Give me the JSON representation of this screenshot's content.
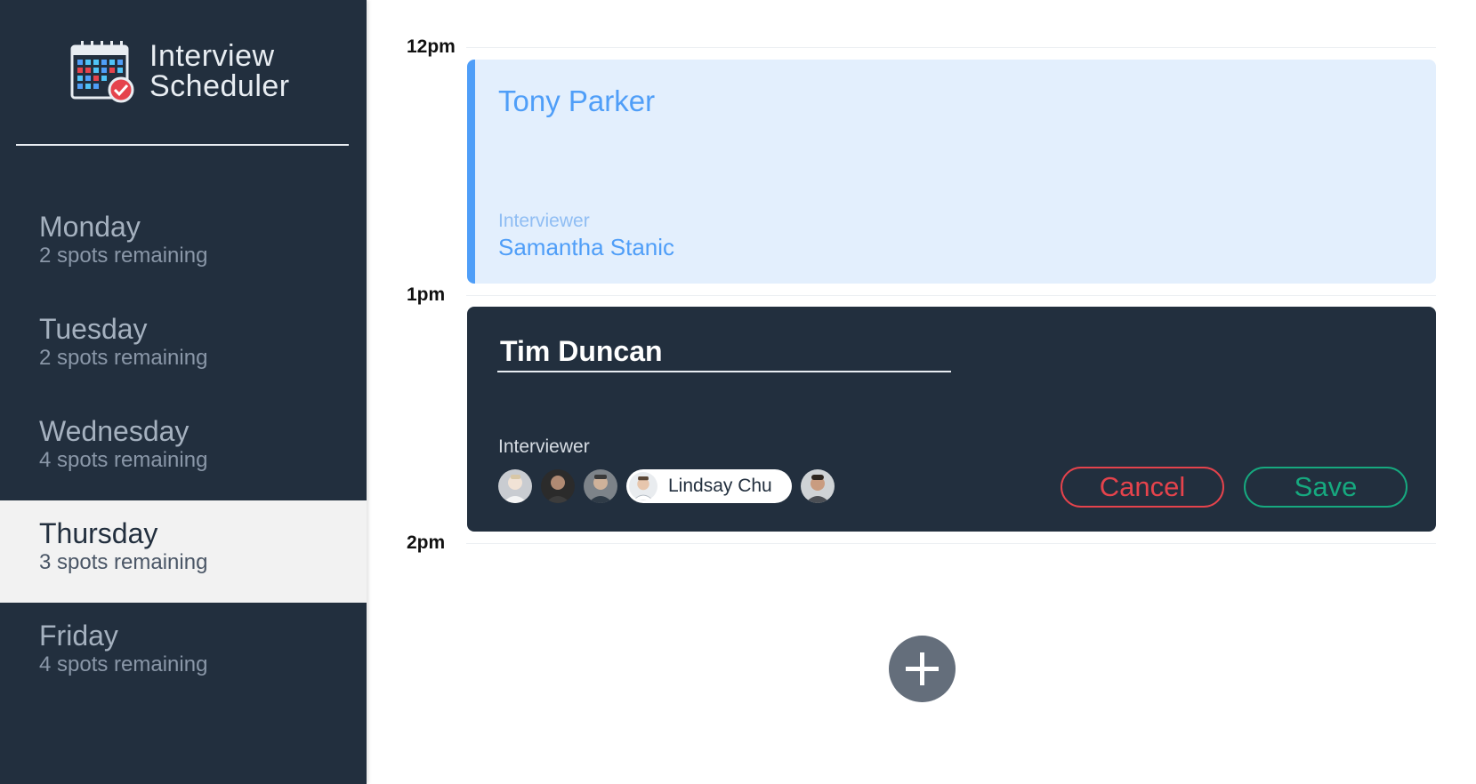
{
  "app": {
    "title_line1": "Interview",
    "title_line2": "Scheduler",
    "logo_icon": "calendar-check-icon"
  },
  "sidebar": {
    "days": [
      {
        "name": "Monday",
        "spots": "2 spots remaining",
        "selected": false
      },
      {
        "name": "Tuesday",
        "spots": "2 spots remaining",
        "selected": false
      },
      {
        "name": "Wednesday",
        "spots": "4 spots remaining",
        "selected": false
      },
      {
        "name": "Thursday",
        "spots": "3 spots remaining",
        "selected": true
      },
      {
        "name": "Friday",
        "spots": "4 spots remaining",
        "selected": false
      }
    ]
  },
  "schedule": {
    "times": [
      "12pm",
      "1pm",
      "2pm"
    ],
    "appointment_show": {
      "student": "Tony Parker",
      "interviewer_label": "Interviewer",
      "interviewer_name": "Samantha Stanic"
    },
    "appointment_edit": {
      "student_value": "Tim Duncan",
      "interviewer_label": "Interviewer",
      "selected_interviewer": "Lindsay Chu",
      "cancel_label": "Cancel",
      "save_label": "Save"
    },
    "add_button_icon": "plus-icon"
  },
  "colors": {
    "sidebar_bg": "#222f3e",
    "accent_blue": "#4f9ef8",
    "show_bg": "#e3effd",
    "danger": "#e5434c",
    "success": "#16a97f",
    "add_button_bg": "#646e7b"
  }
}
